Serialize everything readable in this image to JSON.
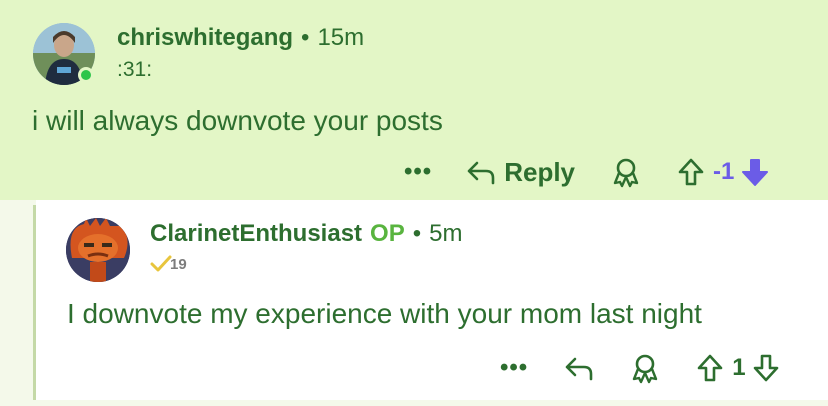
{
  "colors": {
    "parent_bg": "#e3f6c6",
    "text_green": "#2d6e2f",
    "op_green": "#59b43f",
    "downvote_purple": "#6b5ce7",
    "online_dot": "#2dc54a"
  },
  "comment": {
    "username": "chriswhitegang",
    "separator": "•",
    "time": "15m",
    "flair": ":31:",
    "body": "i will always downvote your posts",
    "actions": {
      "more_label": "•••",
      "reply_label": "Reply",
      "award_icon": "award-icon",
      "upvote_icon": "upvote-arrow-icon",
      "score": "-1",
      "downvote_icon": "downvote-arrow-filled-icon",
      "vote_state": "downvoted"
    }
  },
  "reply": {
    "username": "ClarinetEnthusiast",
    "op_label": "OP",
    "separator": "•",
    "time": "5m",
    "badge_number": "19",
    "body": "I downvote my experience with your mom last night",
    "actions": {
      "more_label": "•••",
      "reply_icon": "reply-arrow-icon",
      "award_icon": "award-icon",
      "upvote_icon": "upvote-arrow-icon",
      "score": "1",
      "downvote_icon": "downvote-arrow-icon"
    }
  }
}
